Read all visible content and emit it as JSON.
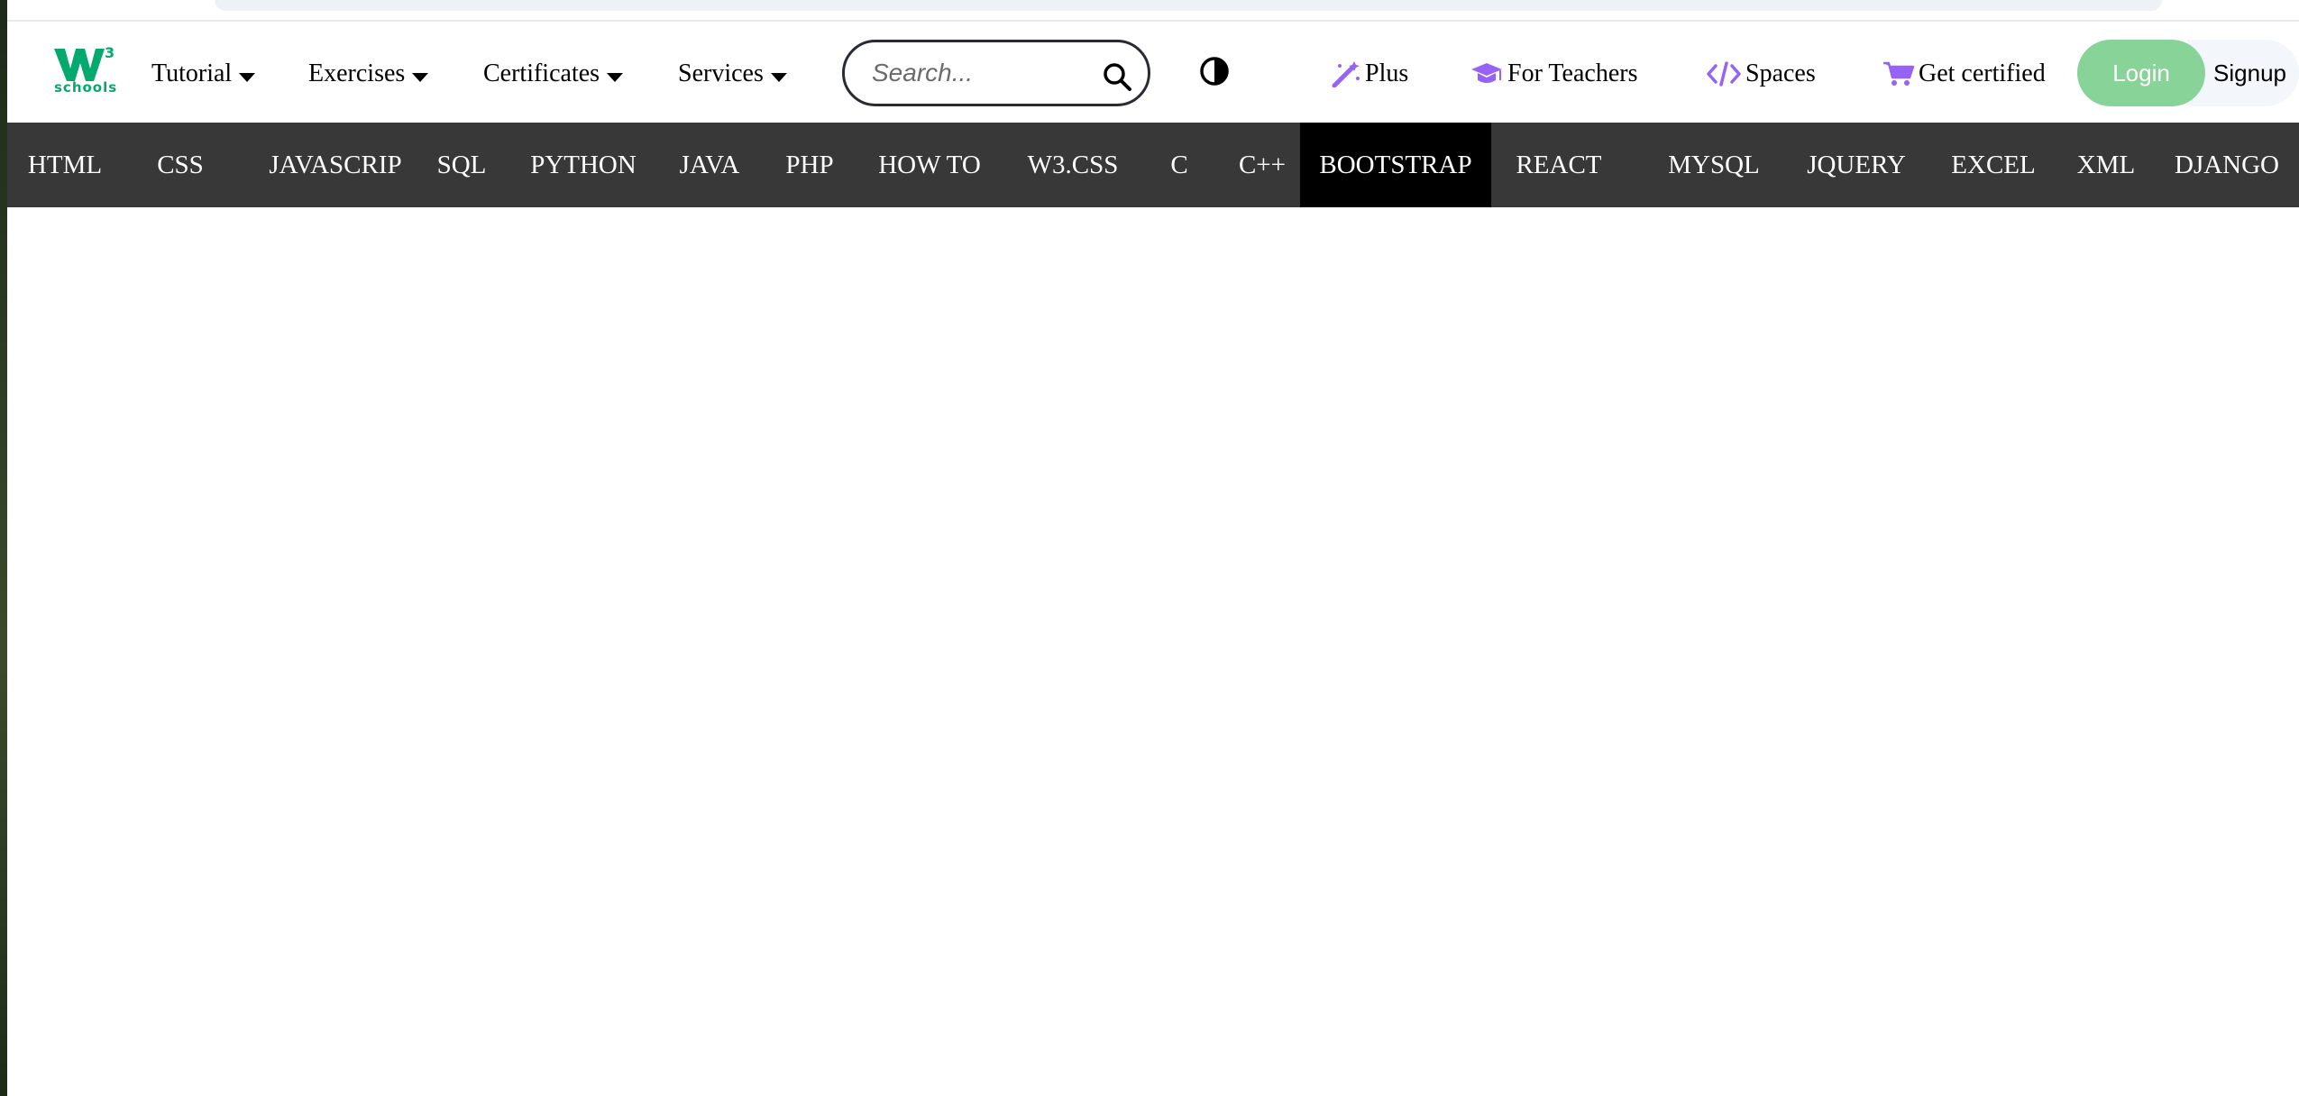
{
  "logo": {
    "text": "schools",
    "superscript": "3",
    "brand_color": "#04aa6d"
  },
  "topnav": {
    "menus": [
      {
        "label": "Tutorial"
      },
      {
        "label": "Exercises"
      },
      {
        "label": "Certificates"
      },
      {
        "label": "Services"
      }
    ],
    "search": {
      "placeholder": "Search...",
      "value": ""
    },
    "links": [
      {
        "label": "Plus",
        "icon": "magic-wand-icon"
      },
      {
        "label": "For Teachers",
        "icon": "graduation-cap-icon"
      },
      {
        "label": "Spaces",
        "icon": "code-icon"
      },
      {
        "label": "Get certified",
        "icon": "cart-icon"
      }
    ],
    "login_label": "Login",
    "signup_label": "Signup",
    "accent_color": "#9763f6",
    "login_color": "#88d498"
  },
  "subjects": {
    "items": [
      {
        "label": "HTML"
      },
      {
        "label": "CSS"
      },
      {
        "label": "JAVASCRIP"
      },
      {
        "label": "SQL"
      },
      {
        "label": "PYTHON"
      },
      {
        "label": "JAVA"
      },
      {
        "label": "PHP"
      },
      {
        "label": "HOW TO"
      },
      {
        "label": "W3.CSS"
      },
      {
        "label": "C"
      },
      {
        "label": "C++"
      },
      {
        "label": "BOOTSTRAP"
      },
      {
        "label": "REACT"
      },
      {
        "label": "MYSQL"
      },
      {
        "label": "JQUERY"
      },
      {
        "label": "EXCEL"
      },
      {
        "label": "XML"
      },
      {
        "label": "DJANGO"
      }
    ],
    "active": "BOOTSTRAP",
    "bar_color": "#383838",
    "active_color": "#000000"
  }
}
